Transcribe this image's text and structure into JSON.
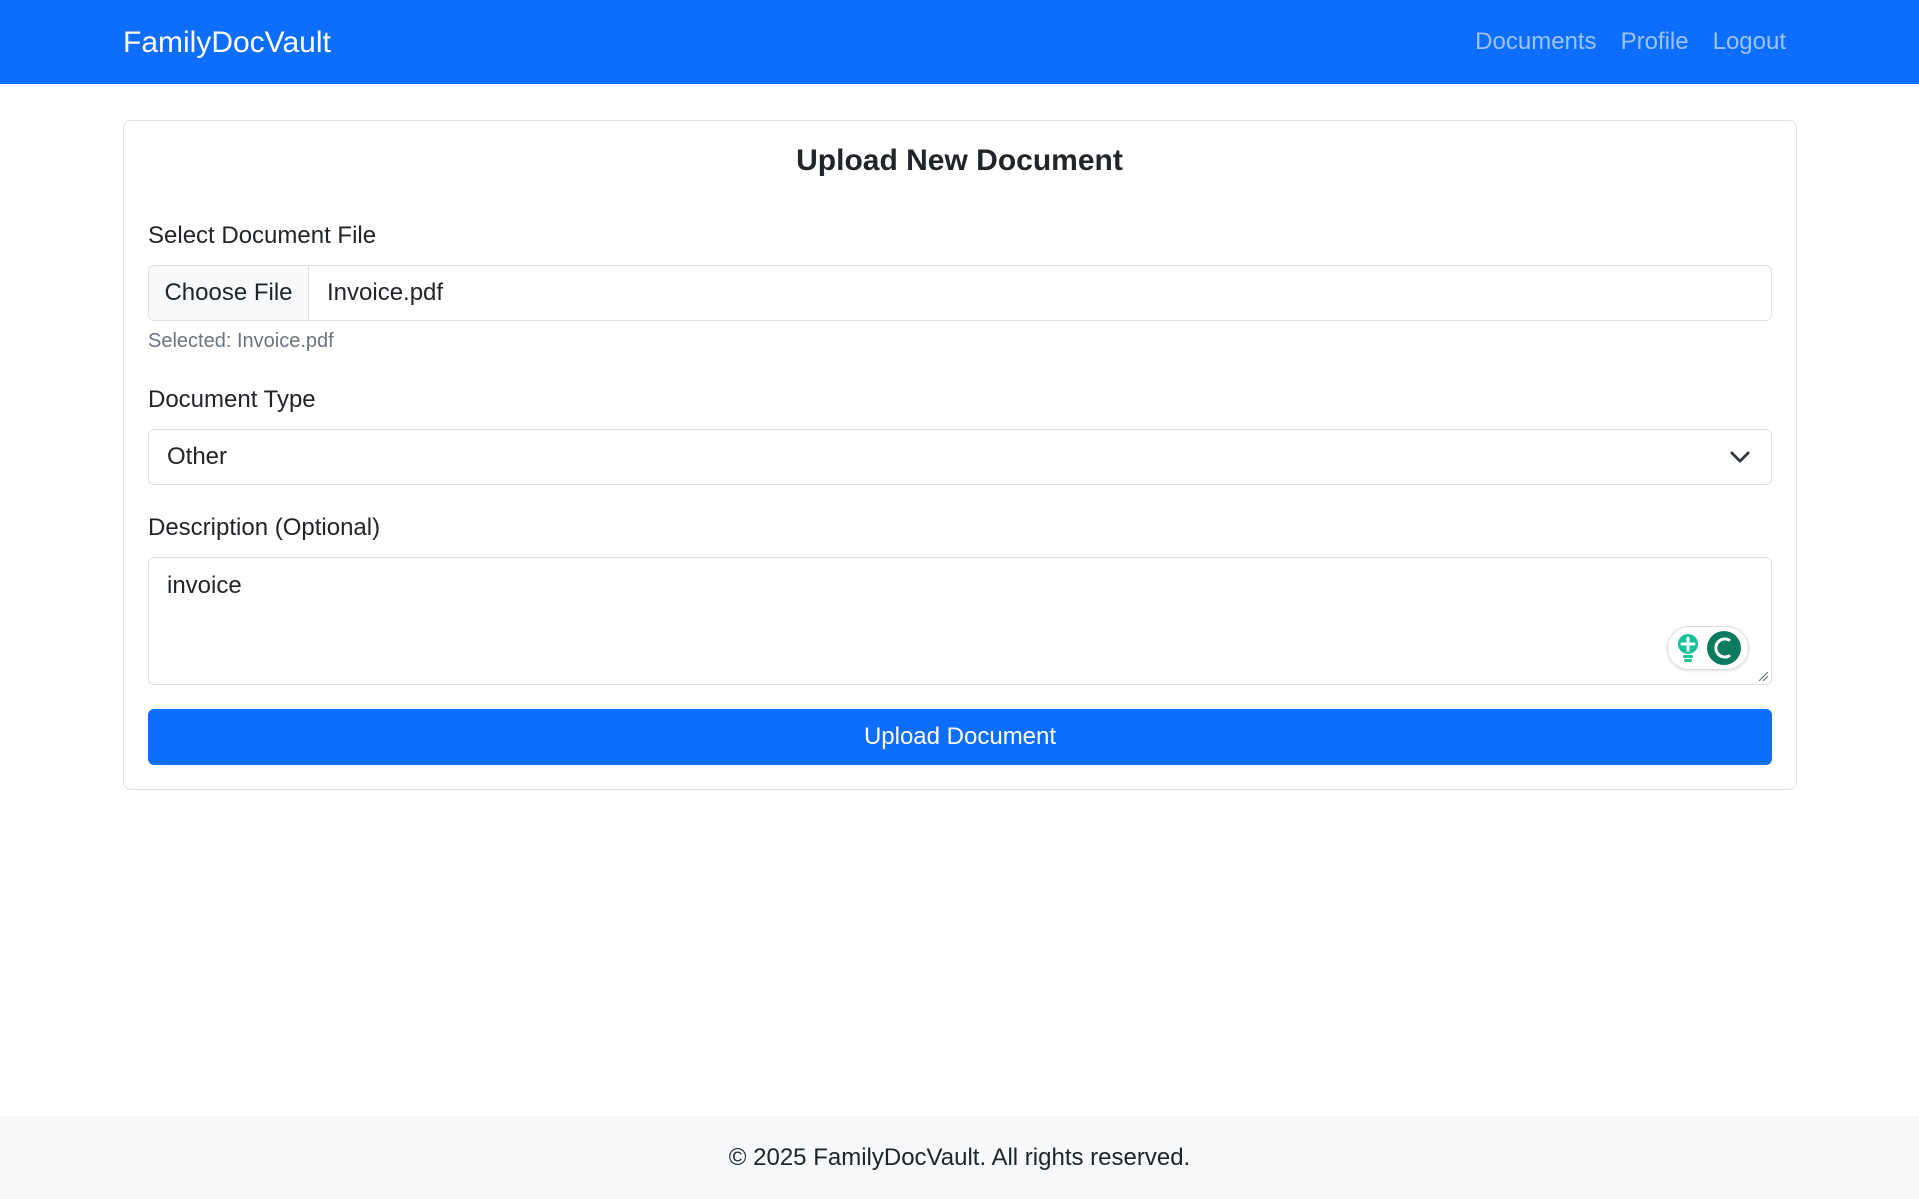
{
  "navbar": {
    "brand": "FamilyDocVault",
    "links": [
      {
        "label": "Documents"
      },
      {
        "label": "Profile"
      },
      {
        "label": "Logout"
      }
    ],
    "color": "#0d6efd"
  },
  "form": {
    "title": "Upload New Document",
    "file": {
      "label": "Select Document File",
      "button": "Choose File",
      "filename": "Invoice.pdf",
      "hint": "Selected: Invoice.pdf"
    },
    "type": {
      "label": "Document Type",
      "selected": "Other"
    },
    "description": {
      "label": "Description (Optional)",
      "value": "invoice"
    },
    "submit_label": "Upload Document"
  },
  "footer": {
    "text": "© 2025 FamilyDocVault. All rights reserved."
  }
}
